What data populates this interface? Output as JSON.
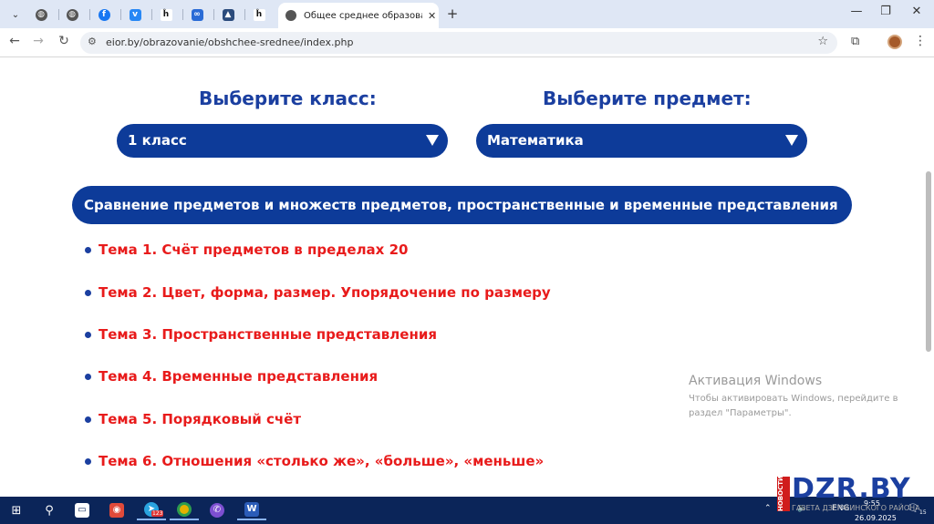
{
  "browser": {
    "active_tab_title": "Общее среднее образование",
    "tab_close": "✕",
    "new_tab": "+",
    "url": "eior.by/obrazovanie/obshchee-srednee/index.php",
    "win_minimize": "—",
    "win_restore": "❐",
    "win_close": "✕"
  },
  "selectors": {
    "class_heading": "Выберите класс:",
    "class_value": "1 класс",
    "subject_heading": "Выберите предмет:",
    "subject_value": "Математика"
  },
  "section_title": "Сравнение предметов и множеств предметов, пространственные и временные представления",
  "topics": [
    "Тема 1. Счёт предметов в пределах 20",
    "Тема 2. Цвет, форма, размер. Упорядочение по размеру",
    "Тема 3. Пространственные представления",
    "Тема 4. Временные представления",
    "Тема 5. Порядковый счёт",
    "Тема 6. Отношения «столько же», «больше», «меньше»"
  ],
  "activation": {
    "title": "Активация Windows",
    "line1": "Чтобы активировать Windows, перейдите в",
    "line2": "раздел \"Параметры\"."
  },
  "watermark": {
    "brand": "DZR.BY",
    "side": "НОВОСТИ",
    "sub": "ГАЗЕТА ДЗЕРЖИНСКОГО РАЙОНА"
  },
  "taskbar": {
    "telegram_badge": "123",
    "lang": "ENG",
    "time": "9:55",
    "date": "26.09.2025",
    "notify_count": "15"
  },
  "colors": {
    "accent_blue": "#0d3b99",
    "heading_blue": "#1b3fa0",
    "topic_red": "#e81b1b"
  }
}
